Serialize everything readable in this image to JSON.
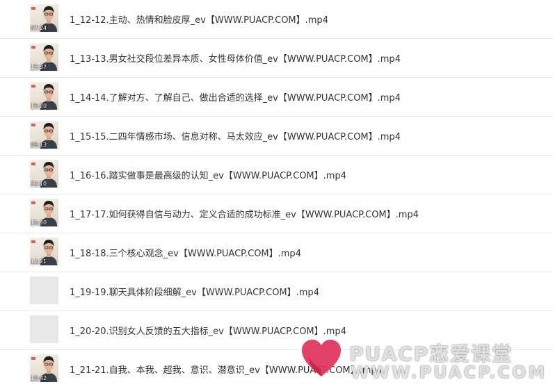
{
  "files": [
    {
      "name": "1_12-12.主动、热情和脸皮厚_ev【WWW.PUACP.COM】.mp4",
      "duration": "07:24",
      "thumbnail": "video-frame"
    },
    {
      "name": "1_13-13.男女社交段位差异本质、女性母体价值_ev【WWW.PUACP.COM】.mp4",
      "duration": "15:37",
      "thumbnail": "video-frame"
    },
    {
      "name": "1_14-14.了解对方、了解自己、做出合适的选择_ev【WWW.PUACP.COM】.mp4",
      "duration": "15:20",
      "thumbnail": "video-frame"
    },
    {
      "name": "1_15-15.二四年情感市场、信息对称、马太效应_ev【WWW.PUACP.COM】.mp4",
      "duration": "09:13",
      "thumbnail": "video-frame"
    },
    {
      "name": "1_16-16.踏实做事是最高级的认知_ev【WWW.PUACP.COM】.mp4",
      "duration": "22:10",
      "thumbnail": "video-frame"
    },
    {
      "name": "1_17-17.如何获得自信与动力、定义合适的成功标准_ev【WWW.PUACP.COM】.mp4",
      "duration": "15:30",
      "thumbnail": "video-frame"
    },
    {
      "name": "1_18-18.三个核心观念_ev【WWW.PUACP.COM】.mp4",
      "duration": "12:21",
      "thumbnail": "video-frame"
    },
    {
      "name": "1_19-19.聊天具体阶段细解_ev【WWW.PUACP.COM】.mp4",
      "duration": "",
      "thumbnail": "placeholder"
    },
    {
      "name": "1_20-20.识别女人反馈的五大指标_ev【WWW.PUACP.COM】.mp4",
      "duration": "",
      "thumbnail": "placeholder"
    },
    {
      "name": "1_21-21.自我、本我、超我、意识、潜意识_ev【WWW.PUACP.COM】.mp4",
      "duration": "19:42",
      "thumbnail": "video-frame"
    }
  ],
  "watermark": {
    "brand": "PUACP恋爱课堂",
    "url": "WWW.PUACP.COM",
    "icon": "heart-logo-icon",
    "color": "#e0325a"
  },
  "colors": {
    "text": "#333333",
    "divider": "#e9e9e9",
    "placeholder_thumb": "#e8e8e8"
  }
}
